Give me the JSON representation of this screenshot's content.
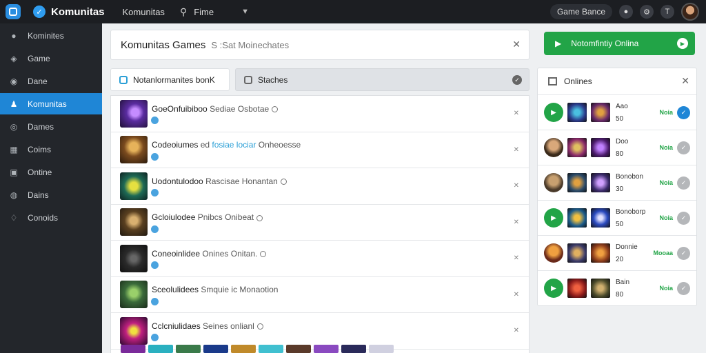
{
  "topbar": {
    "brand": "Komunitas",
    "nav_link": "Komunitas",
    "game_label": "Fime",
    "game_status": "Game Bance"
  },
  "sidebar": {
    "items": [
      {
        "label": "Kominites",
        "icon": "circle-icon"
      },
      {
        "label": "Game",
        "icon": "gamepad-icon"
      },
      {
        "label": "Dane",
        "icon": "controller-icon"
      },
      {
        "label": "Komunitas",
        "icon": "community-icon",
        "active": true
      },
      {
        "label": "Dames",
        "icon": "disc-icon"
      },
      {
        "label": "Coims",
        "icon": "grid-icon"
      },
      {
        "label": "Ontine",
        "icon": "image-icon"
      },
      {
        "label": "Dains",
        "icon": "pin-icon"
      },
      {
        "label": "Conoids",
        "icon": "shield-icon"
      }
    ]
  },
  "main": {
    "title": "Komunitas Games",
    "subtitle": "S :Sat Moinechates",
    "tabs": [
      {
        "label": "Notanlormanites bonK"
      },
      {
        "label": "Staches"
      }
    ],
    "rows": [
      {
        "title": "GoeOnfuibiboo",
        "mid": "Sediae",
        "tail": "Osbotae"
      },
      {
        "title": "Codeoiumes",
        "mid": "ed",
        "highlight": "fosiae lociar",
        "tail": "Onheoesse"
      },
      {
        "title": "Uodontulodoo",
        "mid": "Rascisae",
        "tail": "Honantan"
      },
      {
        "title": "Gcloiulodee",
        "mid": "Pnibcs",
        "tail": "Onibeat"
      },
      {
        "title": "Coneoinlidee",
        "mid": "Onines",
        "tail": "Onitan."
      },
      {
        "title": "Sceolulidees",
        "mid": "Smquie",
        "tail": "ic Monaotion"
      },
      {
        "title": "Cclcniulidaes",
        "mid": "Seines",
        "tail": "onlianl"
      }
    ]
  },
  "online_button": {
    "label": "Notomfintiy Onlina"
  },
  "online_panel": {
    "title": "Onlines",
    "rows": [
      {
        "name": "Aao",
        "count": "50",
        "tag": "Noia",
        "checked": true
      },
      {
        "name": "Doo",
        "count": "80",
        "tag": "Noia",
        "checked": false
      },
      {
        "name": "Bonobon",
        "count": "30",
        "tag": "Noia",
        "checked": false
      },
      {
        "name": "Bonoborp",
        "count": "50",
        "tag": "Noia",
        "checked": false
      },
      {
        "name": "Donnie",
        "count": "20",
        "tag": "Mooaa",
        "checked": false
      },
      {
        "name": "Bain",
        "count": "80",
        "tag": "Noia",
        "checked": false
      }
    ]
  }
}
